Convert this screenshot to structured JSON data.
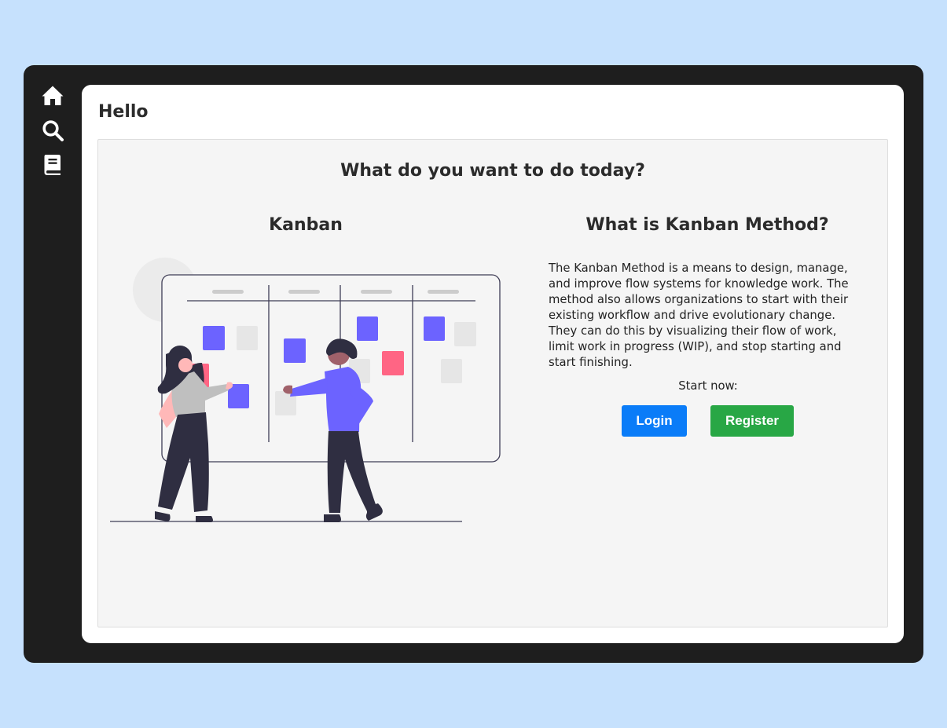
{
  "nav": {
    "items": [
      {
        "icon": "home-icon"
      },
      {
        "icon": "search-icon"
      },
      {
        "icon": "book-icon"
      }
    ]
  },
  "page": {
    "title": "Hello"
  },
  "main": {
    "heading": "What do you want to do today?",
    "left": {
      "heading": "Kanban",
      "illustration": "kanban-board-illustration"
    },
    "right": {
      "heading": "What is Kanban Method?",
      "description": "The Kanban Method is a means to design, manage, and improve flow systems for knowledge work. The method also allows organizations to start with their existing workflow and drive evolutionary change. They can do this by visualizing their flow of work, limit work in progress (WIP), and stop starting and start finishing.",
      "start_label": "Start now:",
      "login_label": "Login",
      "register_label": "Register"
    }
  },
  "colors": {
    "background": "#c6e1fd",
    "frame": "#1e1e1e",
    "accent": "#6c63ff",
    "card_pink": "#ff6584",
    "login": "#0a7cf8",
    "register": "#28a745"
  }
}
